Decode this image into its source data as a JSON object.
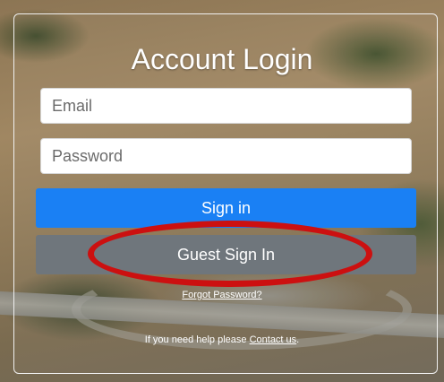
{
  "login": {
    "title": "Account Login",
    "email_placeholder": "Email",
    "password_placeholder": "Password",
    "signin_label": "Sign in",
    "guest_label": "Guest Sign In",
    "forgot_label": "Forgot Password?",
    "help_prefix": "If you need help please ",
    "contact_label": "Contact us",
    "help_suffix": "."
  },
  "colors": {
    "signin_button": "#1a80f4",
    "guest_button": "#6f767c",
    "annotation_ring": "#cc1010"
  }
}
